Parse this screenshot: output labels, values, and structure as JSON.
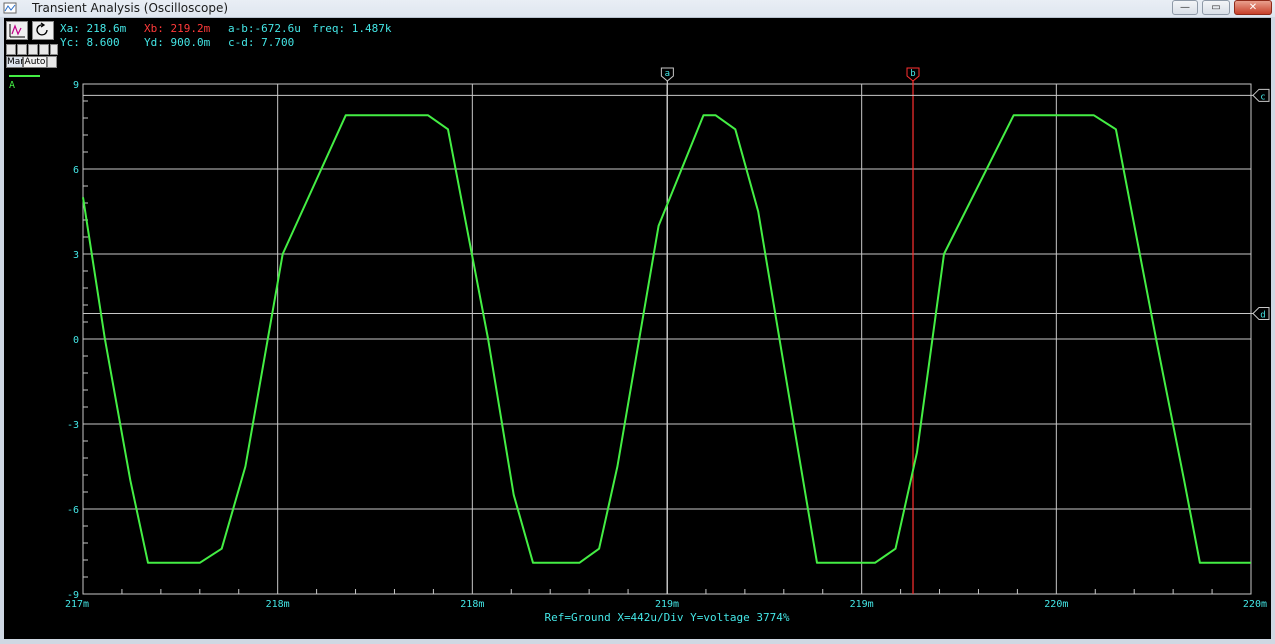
{
  "window": {
    "title": "Transient Analysis (Oscilloscope)",
    "min_glyph": "—",
    "max_glyph": "▭",
    "close_glyph": "✕"
  },
  "toolbar": {
    "mode_manual": "Man",
    "mode_auto": "Auto"
  },
  "readouts": {
    "xa": "Xa: 218.6m",
    "xb": "Xb: 219.2m",
    "a_b": "a-b:-672.6u",
    "freq": "freq: 1.487k",
    "yc": "Yc: 8.600",
    "yd": "Yd: 900.0m",
    "c_d": "c-d: 7.700"
  },
  "legend": {
    "trace_label": "A",
    "trace_color": "#44ee44"
  },
  "status_line": "Ref=Ground  X=442u/Div Y=voltage 3774%",
  "colors": {
    "background": "#000000",
    "grid": "#c8c8c8",
    "axis_text": "#44e6e6",
    "trace": "#44ee44",
    "cursor_a": "#c8c8c8",
    "cursor_b": "#ff3030"
  },
  "chart_data": {
    "type": "line",
    "x_unit": "seconds",
    "xlim": [
      0.217,
      0.2202
    ],
    "ylim": [
      -9,
      9
    ],
    "x_tick_labels": [
      "217m",
      "218m",
      "218m",
      "219m",
      "219m",
      "220m",
      "220m"
    ],
    "y_tick_values": [
      9,
      6,
      3,
      0,
      -3,
      -6,
      -9
    ],
    "y_tick_labels": [
      "9",
      "6",
      "3",
      "0",
      "-3",
      "-6",
      "-9"
    ],
    "grid": true,
    "series": [
      {
        "name": "A",
        "color": "#44ee44",
        "x": [
          0.217,
          0.21706,
          0.21713,
          0.217178,
          0.21732,
          0.21738,
          0.217445,
          0.217547,
          0.21772,
          0.217945,
          0.218,
          0.21811,
          0.21818,
          0.218233,
          0.21836,
          0.218414,
          0.218464,
          0.218577,
          0.2187,
          0.218733,
          0.218787,
          0.21885,
          0.21896,
          0.219011,
          0.21917,
          0.219226,
          0.219285,
          0.219359,
          0.21955,
          0.219769,
          0.21983,
          0.21994,
          0.220017,
          0.22006,
          0.2202
        ],
        "y": [
          5.0,
          0.0,
          -5.0,
          -7.9,
          -7.9,
          -7.4,
          -4.5,
          3.0,
          7.9,
          7.9,
          7.4,
          0.0,
          -5.5,
          -7.9,
          -7.9,
          -7.4,
          -4.5,
          4.0,
          7.9,
          7.9,
          7.4,
          4.5,
          -4.0,
          -7.9,
          -7.9,
          -7.4,
          -4.0,
          3.0,
          7.9,
          7.9,
          7.4,
          0.0,
          -5.0,
          -7.9,
          -7.9
        ]
      }
    ],
    "cursors": [
      {
        "label": "a",
        "orientation": "vertical",
        "x": 0.218601,
        "color": "#c8c8c8"
      },
      {
        "label": "b",
        "orientation": "vertical",
        "x": 0.219274,
        "color": "#ff3030"
      },
      {
        "label": "c",
        "orientation": "horizontal",
        "y": 8.6,
        "color": "#c8c8c8"
      },
      {
        "label": "d",
        "orientation": "horizontal",
        "y": 0.9,
        "color": "#c8c8c8"
      }
    ]
  }
}
